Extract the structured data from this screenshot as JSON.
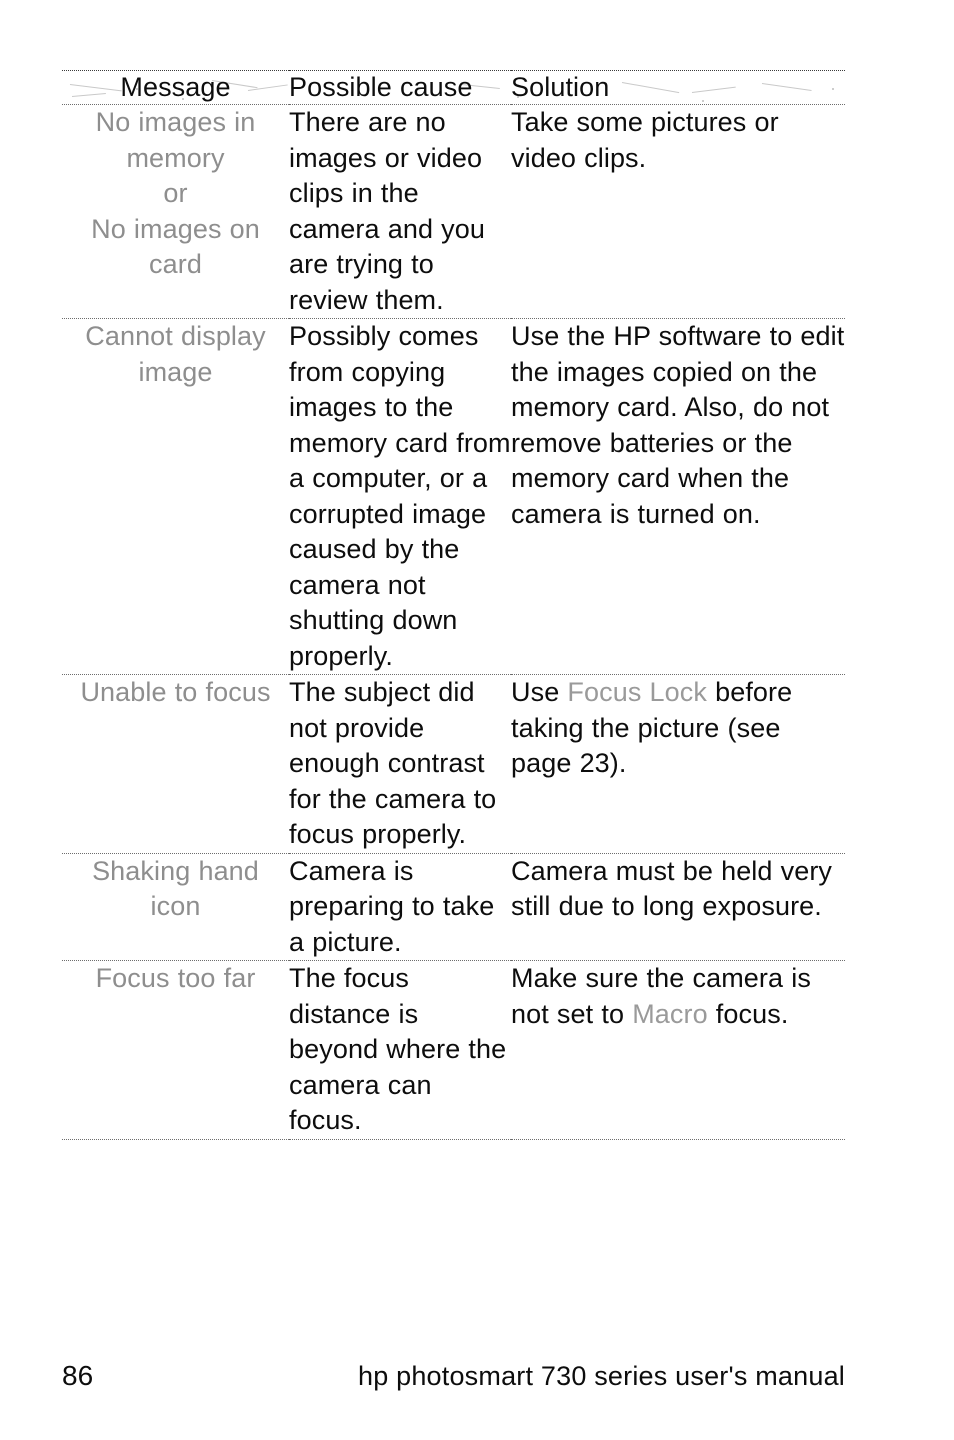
{
  "page": {
    "number": "86",
    "footer_title": "hp photosmart 730 series user's manual"
  },
  "table": {
    "headers": {
      "message": "Message",
      "cause": "Possible cause",
      "solution": "Solution"
    },
    "rows": [
      {
        "message": "No images in\nmemory\nor\nNo images on\ncard",
        "cause": "There are no images or video clips in the camera and you are trying to review them.",
        "solution": "Take some pictures or video clips."
      },
      {
        "message": "Cannot display\nimage",
        "cause": "Possibly comes from copying images to the memory card from a computer, or a corrupted image caused by the camera not shutting down properly.",
        "solution": "Use the HP software to edit the images copied on the memory card. Also, do not remove batteries or the memory card when the camera is turned on."
      },
      {
        "message": "Unable to focus",
        "cause": "The subject did not provide enough contrast for the camera to focus properly.",
        "solution_parts": [
          {
            "text": "Use ",
            "style": "normal"
          },
          {
            "text": "Focus Lock",
            "style": "ui-term"
          },
          {
            "text": " before taking the picture (see page 23).",
            "style": "normal"
          }
        ]
      },
      {
        "message": "Shaking hand\nicon",
        "cause": "Camera is preparing to take a picture.",
        "solution": "Camera must be held very still due to long exposure."
      },
      {
        "message": "Focus too far",
        "cause": "The focus distance is beyond where the camera can focus.",
        "solution_parts": [
          {
            "text": "Make sure the camera is not set to ",
            "style": "normal"
          },
          {
            "text": "Macro",
            "style": "ui-term"
          },
          {
            "text": " focus.",
            "style": "normal"
          }
        ]
      }
    ]
  },
  "colors": {
    "body_text": "#0d0d0d",
    "message_column_text": "#8e8e8e",
    "ui_term_text": "#9a9a9a",
    "rule": "#6d6d6d",
    "background": "#ffffff"
  }
}
